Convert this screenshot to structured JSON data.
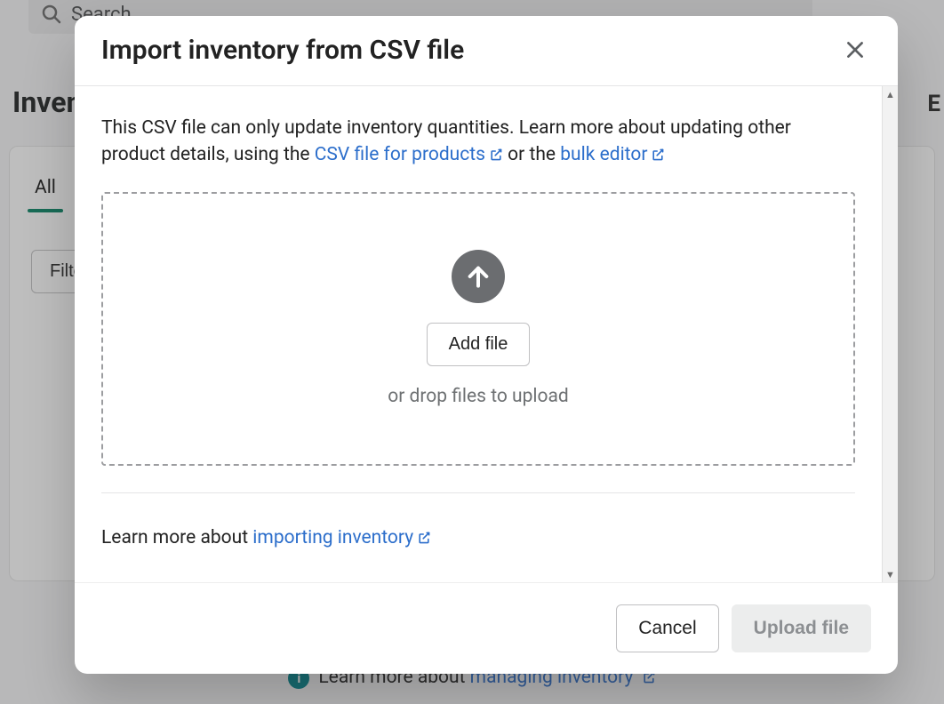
{
  "background": {
    "search_placeholder": "Search",
    "page_title": "Inventory",
    "right_trunc": "E",
    "tabs": {
      "all": "All"
    },
    "filter_button": "Filter",
    "footer_text": "Learn more about ",
    "footer_link": "managing inventory"
  },
  "modal": {
    "title": "Import inventory from CSV file",
    "desc_part1": "This CSV file can only update inventory quantities. Learn more about updating other product details, using the ",
    "link_csv": "CSV file for products",
    "desc_part2": " or the ",
    "link_bulk": "bulk editor",
    "dropzone": {
      "add_file": "Add file",
      "hint": "or drop files to upload"
    },
    "footnote_prefix": "Learn more about ",
    "footnote_link": "importing inventory",
    "cancel": "Cancel",
    "upload": "Upload file"
  }
}
